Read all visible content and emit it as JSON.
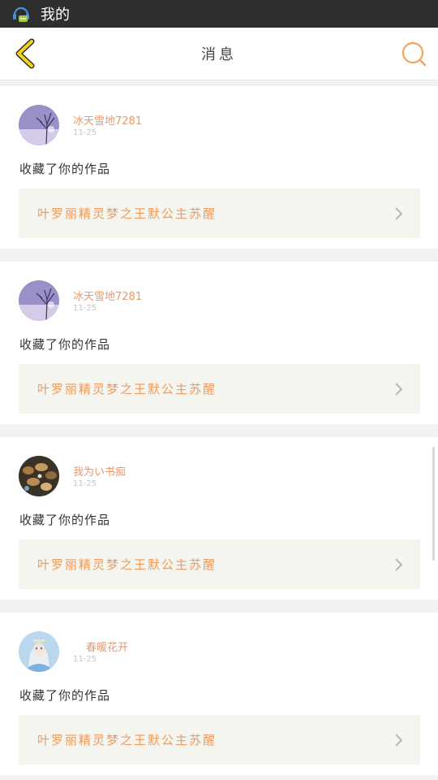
{
  "status_bar": {
    "app_title": "我的",
    "icon": "headset-chat-icon"
  },
  "header": {
    "title": "消息",
    "back_icon": "chevron-left-icon",
    "search_icon": "search-icon",
    "accent": "#f5a25d"
  },
  "notifications": [
    {
      "username": "冰天雪地7281",
      "date": "11-25",
      "action": "收藏了你的作品",
      "work_title": "叶罗丽精灵梦之王默公主苏醒",
      "avatar": "winter-tree-avatar"
    },
    {
      "username": "冰天雪地7281",
      "date": "11-25",
      "action": "收藏了你的作品",
      "work_title": "叶罗丽精灵梦之王默公主苏醒",
      "avatar": "winter-tree-avatar"
    },
    {
      "username": "我为い书痴",
      "date": "11-25",
      "action": "收藏了你的作品",
      "work_title": "叶罗丽精灵梦之王默公主苏醒",
      "avatar": "pebbles-avatar"
    },
    {
      "username": "春暖花开",
      "date": "11-25",
      "action": "收藏了你的作品",
      "work_title": "叶罗丽精灵梦之王默公主苏醒",
      "avatar": "doll-avatar"
    }
  ]
}
